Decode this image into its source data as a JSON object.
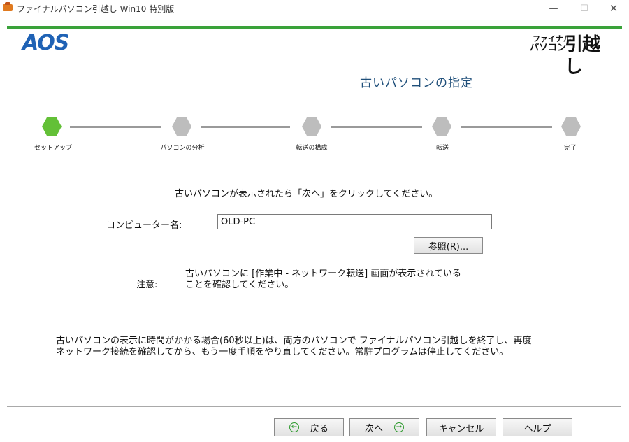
{
  "window": {
    "title": "ファイナルパソコン引越し Win10 特別版",
    "min_glyph": "—",
    "max_glyph": "☐",
    "close_glyph": "✕"
  },
  "logos": {
    "left": "AOS",
    "right_line1": "ファイナル",
    "right_line2": "パソコン",
    "right_big": "引越し"
  },
  "page": {
    "title": "古いパソコンの指定"
  },
  "steps": [
    {
      "label": "セットアップ",
      "active": true
    },
    {
      "label": "パソコンの分析",
      "active": false
    },
    {
      "label": "転送の構成",
      "active": false
    },
    {
      "label": "転送",
      "active": false
    },
    {
      "label": "完了",
      "active": false
    }
  ],
  "colors": {
    "accent_green": "#3aa23a",
    "active_step": "#63c037",
    "inactive_step": "#bdbdbd",
    "logo_blue": "#1f62b5",
    "title_blue": "#1f4f7a"
  },
  "main": {
    "instruction": "古いパソコンが表示されたら「次へ」をクリックしてください。",
    "computer_name_label": "コンピューター名:",
    "computer_name_value": "OLD-PC",
    "browse_label": "参照(R)...",
    "note_label": "注意:",
    "note_line1": "古いパソコンに [作業中 - ネットワーク転送] 画面が表示されている",
    "note_line2": "ことを確認してください。",
    "bottom_line1": "古いパソコンの表示に時間がかかる場合(60秒以上)は、両方のパソコンで ファイナルパソコン引越しを終了し、再度",
    "bottom_line2": "ネットワーク接続を確認してから、もう一度手順をやり直してください。常駐プログラムは停止してください。"
  },
  "buttons": {
    "back": "戻る",
    "next": "次へ",
    "cancel": "キャンセル",
    "help": "ヘルプ",
    "back_icon": "left-arrow-circle-icon",
    "next_icon": "right-arrow-circle-icon"
  }
}
